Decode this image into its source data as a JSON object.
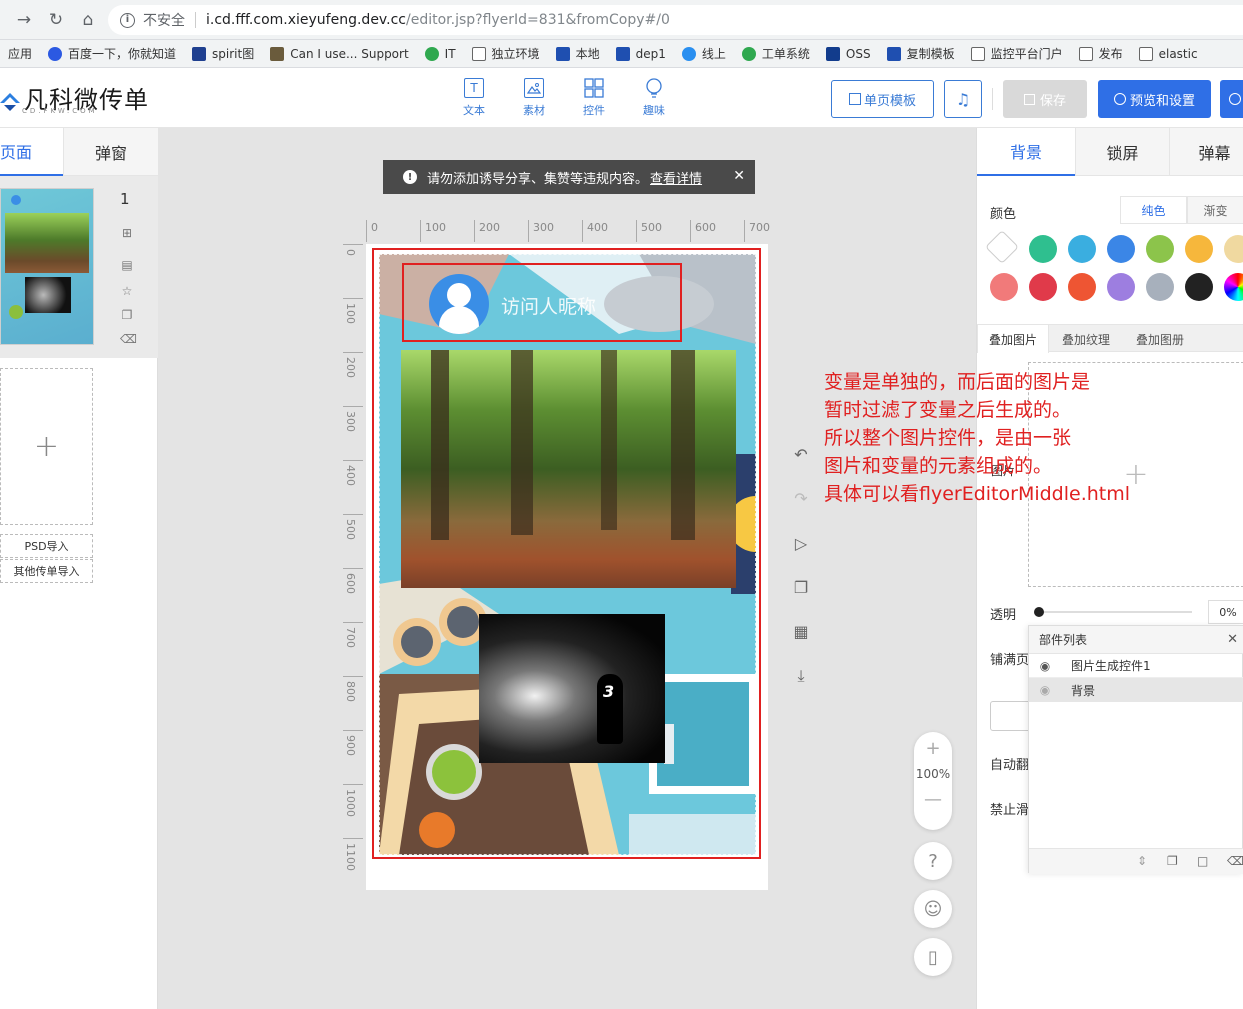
{
  "browser": {
    "back_icon": "arrow-left-icon",
    "url_insecure_label": "不安全",
    "url_host": "i.cd.fff.com.xieyufeng.dev.cc",
    "url_path": "/editor.jsp?flyerId=831&fromCopy#/0",
    "bookmarks": [
      "应用",
      "百度一下，你就知道",
      "spirit图",
      "Can I use... Support",
      "IT",
      "独立环境",
      "本地",
      "dep1",
      "线上",
      "工单系统",
      "OSS",
      "复制模板",
      "监控平台门户",
      "发布",
      "elastic"
    ]
  },
  "header": {
    "logo_text": "凡科微传单",
    "logo_sub": "CD.FKW.COM",
    "tools": [
      {
        "label": "文本",
        "icon": "text-icon"
      },
      {
        "label": "素材",
        "icon": "image-icon"
      },
      {
        "label": "控件",
        "icon": "widgets-icon"
      },
      {
        "label": "趣味",
        "icon": "bulb-icon"
      }
    ],
    "single_page_template_label": "单页模板",
    "music_icon": "music-icon",
    "save_label": "保存",
    "preview_label": "预览和设置"
  },
  "left_panel": {
    "tab_pages": "页面",
    "tab_popup": "弹窗",
    "page_number": "1",
    "psd_import": "PSD导入",
    "other_import": "其他传单导入"
  },
  "canvas": {
    "notice_text": "请勿添加诱导分享、集赞等违规内容。",
    "notice_link": "查看详情",
    "ruler_h": [
      "0",
      "100",
      "200",
      "300",
      "400",
      "500",
      "600",
      "700"
    ],
    "ruler_v": [
      "0",
      "100",
      "200",
      "300",
      "400",
      "500",
      "600",
      "700",
      "800",
      "900",
      "1000",
      "1100"
    ],
    "visitor_badge": "访问人",
    "visitor_name": "访问人昵称",
    "zoom_label": "100%",
    "help_label": "?"
  },
  "annotation": {
    "lines": [
      "变量是单独的，而后面的图片是",
      "暂时过滤了变量之后生成的。",
      "所以整个图片控件，是由一张",
      "图片和变量的元素组成的。",
      "具体可以看flyerEditorMiddle.html"
    ]
  },
  "right_panel": {
    "tab_bg": "背景",
    "tab_lock": "锁屏",
    "tab_danmaku": "弹幕",
    "color_label": "颜色",
    "solid_label": "纯色",
    "gradient_label": "渐变",
    "swatches_row1": [
      "#ffffff",
      "#2fbf8f",
      "#3aaee0",
      "#3b86e6",
      "#8cc44b",
      "#f6b73c",
      "#f0d9a0"
    ],
    "swatches_row2": [
      "#f17a7a",
      "#e03a4a",
      "#ee5533",
      "#9d7ee0",
      "#a7b0bc",
      "#222222",
      "rainbow"
    ],
    "overlay_tabs": [
      "叠加图片",
      "叠加纹理",
      "叠加图册"
    ],
    "overlay_truncated": "图片",
    "opacity_label": "透明",
    "opacity_value": "0%",
    "fill_page_label": "铺满页",
    "auto_label": "自动翻",
    "disable_label": "禁止滑",
    "layers_title": "部件列表",
    "layers": [
      "图片生成控件1",
      "背景"
    ]
  }
}
